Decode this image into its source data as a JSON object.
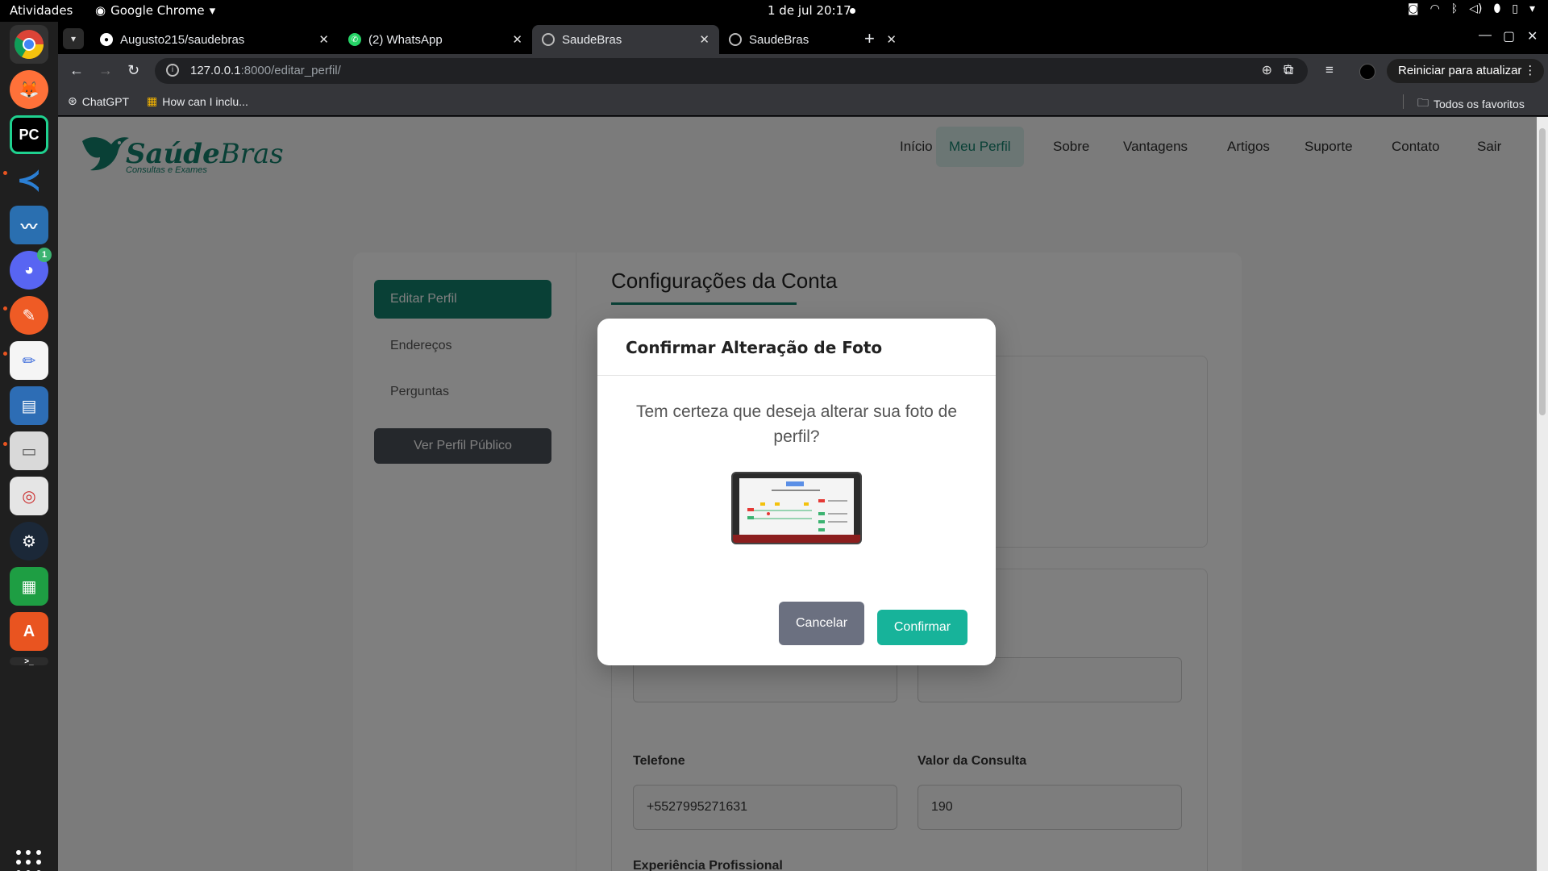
{
  "system_bar": {
    "activities": "Atividades",
    "app_name": "Google Chrome",
    "clock": "1 de jul  20:17"
  },
  "dock": {
    "apps": [
      {
        "name": "chrome",
        "color": "#4285f4"
      },
      {
        "name": "firefox",
        "color": "#ff7139"
      },
      {
        "name": "pycharm",
        "color": "#1fd18f"
      },
      {
        "name": "vscode",
        "color": "#2b7fd4"
      },
      {
        "name": "system-monitor",
        "color": "#2a6fb0"
      },
      {
        "name": "discord",
        "color": "#5865f2",
        "badge": "1"
      },
      {
        "name": "postman",
        "color": "#ef5b25"
      },
      {
        "name": "text-editor",
        "color": "#3d6cdb"
      },
      {
        "name": "writer",
        "color": "#2d6db5"
      },
      {
        "name": "files",
        "color": "#d9d9d9"
      },
      {
        "name": "document-viewer",
        "color": "#e5e5e5"
      },
      {
        "name": "steam",
        "color": "#1b2838"
      },
      {
        "name": "calc",
        "color": "#1e9e43"
      },
      {
        "name": "app-center",
        "color": "#e95420"
      }
    ]
  },
  "browser": {
    "tabs": [
      {
        "title": "Augusto215/saudebras",
        "icon": "github-icon"
      },
      {
        "title": "(2) WhatsApp",
        "icon": "whatsapp-icon"
      },
      {
        "title": "SaudeBras",
        "icon": "globe-icon"
      },
      {
        "title": "SaudeBras",
        "icon": "globe-icon"
      }
    ],
    "url_host": "127.0.0.1",
    "url_path": ":8000/editar_perfil/",
    "restart_label": "Reiniciar para atualizar",
    "bookmarks": [
      {
        "label": "ChatGPT"
      },
      {
        "label": "How can I inclu..."
      }
    ],
    "all_bookmarks": "Todos os favoritos"
  },
  "site": {
    "logo_main": "Saúde",
    "logo_bold2": "Bras",
    "logo_sub": "Consultas e Exames",
    "nav": [
      "Início",
      "Meu Perfil",
      "Sobre",
      "Vantagens",
      "Artigos",
      "Suporte",
      "Contato",
      "Sair"
    ],
    "sidebar": {
      "edit_profile": "Editar Perfil",
      "addresses": "Endereços",
      "questions": "Perguntas",
      "public_profile": "Ver Perfil Público"
    },
    "section_title": "Configurações da Conta",
    "fields": {
      "phone_label": "Telefone",
      "phone_value": "+5527995271631",
      "price_label": "Valor da Consulta",
      "price_value": "190",
      "experience_label": "Experiência Profissional"
    },
    "accent_color": "#13806d"
  },
  "modal": {
    "title": "Confirmar Alteração de Foto",
    "message": "Tem certeza que deseja alterar sua foto de perfil?",
    "cancel": "Cancelar",
    "confirm": "Confirmar"
  }
}
